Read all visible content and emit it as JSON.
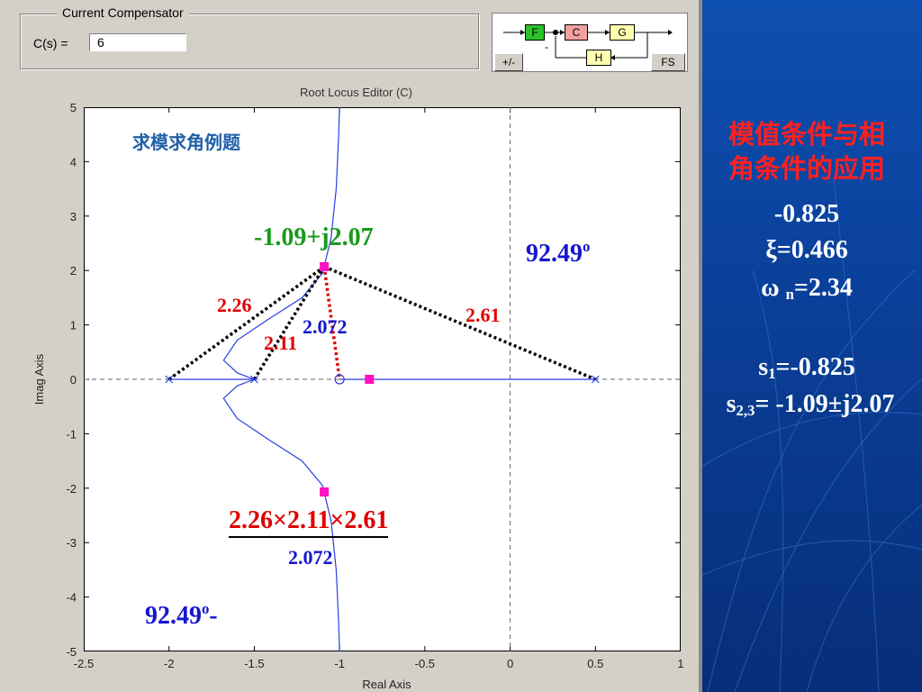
{
  "compensator": {
    "group_title": "Current Compensator",
    "cs_label": "C(s) =",
    "cs_value": "6"
  },
  "block_diagram": {
    "blocks": {
      "f": "F",
      "c": "C",
      "g": "G",
      "h": "H"
    },
    "sign_button": "+/-",
    "fs_button": "FS",
    "feedback_sign": "-",
    "colors": {
      "f": "#29c229",
      "c": "#f3a0a0",
      "g": "#ffffb0",
      "h": "#ffffb0"
    }
  },
  "plot": {
    "title": "Root Locus Editor (C)",
    "xlabel": "Real Axis",
    "ylabel": "Imag Axis"
  },
  "chart_data": {
    "type": "scatter",
    "title": "Root Locus Editor (C)",
    "xlabel": "Real Axis",
    "ylabel": "Imag Axis",
    "xlim": [
      -2.5,
      1
    ],
    "ylim": [
      -5,
      5
    ],
    "xticks": [
      -2.5,
      -2,
      -1.5,
      -1,
      -0.5,
      0,
      0.5,
      1
    ],
    "yticks": [
      -5,
      -4,
      -3,
      -2,
      -1,
      0,
      1,
      2,
      3,
      4,
      5
    ],
    "xtick_labels": [
      "-2.5",
      "-2",
      "-1.5",
      "-1",
      "-0.5",
      "0",
      "0.5",
      "1"
    ],
    "ytick_labels": [
      "-5",
      "-4",
      "-3",
      "-2",
      "-1",
      "0",
      "1",
      "2",
      "3",
      "4",
      "5"
    ],
    "open_loop_poles": [
      [
        -2,
        0
      ],
      [
        -1.5,
        0
      ],
      [
        0.5,
        0
      ]
    ],
    "open_loop_zeros": [
      [
        -1,
        0
      ]
    ],
    "closed_loop_poles": [
      [
        -0.825,
        0
      ],
      [
        -1.09,
        2.07
      ],
      [
        -1.09,
        -2.07
      ]
    ],
    "root_locus_upper": [
      [
        -1.5,
        0
      ],
      [
        -1.6,
        0.12
      ],
      [
        -1.68,
        0.35
      ],
      [
        -1.6,
        0.72
      ],
      [
        -1.42,
        1.1
      ],
      [
        -1.22,
        1.5
      ],
      [
        -1.1,
        1.95
      ],
      [
        -1.05,
        2.6
      ],
      [
        -1.02,
        3.5
      ],
      [
        -1.005,
        4.5
      ],
      [
        -1.0,
        5.0
      ]
    ],
    "root_locus_lower": [
      [
        -1.5,
        0
      ],
      [
        -1.6,
        -0.12
      ],
      [
        -1.68,
        -0.35
      ],
      [
        -1.6,
        -0.72
      ],
      [
        -1.42,
        -1.1
      ],
      [
        -1.22,
        -1.5
      ],
      [
        -1.1,
        -1.95
      ],
      [
        -1.05,
        -2.6
      ],
      [
        -1.02,
        -3.5
      ],
      [
        -1.005,
        -4.5
      ],
      [
        -1.0,
        -5.0
      ]
    ],
    "real_axis_segments": [
      [
        -2,
        -1.5
      ],
      [
        -1,
        0.5
      ]
    ],
    "asymptote_x": 0,
    "grid": false,
    "colors": {
      "locus": "#2a3fe0",
      "pole_marker": "#2a3fe0",
      "closed_loop_marker": "#ff10c0",
      "construction_black": "#000000",
      "construction_red": "#e00000"
    }
  },
  "annotations": {
    "title_cn": "求模求角例题",
    "pole_label": "-1.09+j2.07",
    "angle_top": "92.49",
    "angle_top_sup": "o",
    "len_226": "2.26",
    "len_211": "2.11",
    "len_2072_top": "2.072",
    "len_261": "2.61",
    "product": "2.26×2.11×2.61",
    "product_denominator": "2.072",
    "angle_bottom": "92.49",
    "angle_bottom_sup": "o",
    "angle_bottom_suffix": "-"
  },
  "right_panel": {
    "heading_line1": "模值条件与相",
    "heading_line2": "角条件的应用",
    "sigma": "-0.825",
    "xi": "ξ=0.466",
    "wn_symbol": "ω",
    "wn_sub": "n",
    "wn_value": "=2.34",
    "s1_symbol": "s",
    "s1_sub": "1",
    "s1_value": "=-0.825",
    "s23_symbol": "s",
    "s23_sub": "2,3",
    "s23_value": "= -1.09±j2.07",
    "colors": {
      "heading": "#ff2020",
      "body": "#ffffff",
      "background": "#0a3f98"
    }
  }
}
